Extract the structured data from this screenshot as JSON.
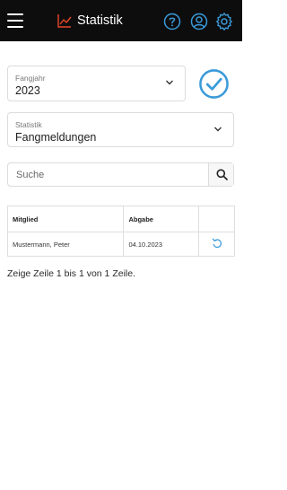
{
  "header": {
    "title": "Statistik",
    "accent_color": "#e8472a",
    "icon_color": "#3a9ad9"
  },
  "filters": {
    "fangjahr": {
      "label": "Fangjahr",
      "value": "2023"
    },
    "statistik": {
      "label": "Statistik",
      "value": "Fangmeldungen"
    }
  },
  "search": {
    "placeholder": "Suche"
  },
  "table": {
    "columns": [
      "Mitglied",
      "Abgabe",
      ""
    ],
    "rows": [
      {
        "mitglied": "Mustermann, Peter",
        "abgabe": "04.10.2023",
        "action_icon": "undo-icon"
      }
    ]
  },
  "pagination_info": "Zeige Zeile 1 bis 1 von 1 Zeile."
}
